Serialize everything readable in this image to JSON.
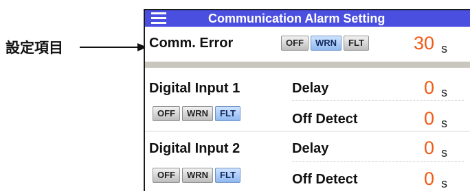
{
  "callout": {
    "label": "設定項目"
  },
  "titlebar": {
    "title": "Communication Alarm Setting",
    "menu_icon": "hamburger-menu-icon"
  },
  "segment_options": [
    "OFF",
    "WRN",
    "FLT"
  ],
  "comm_error": {
    "label": "Comm. Error",
    "selected": "WRN",
    "value": "30",
    "unit": "s"
  },
  "digital_inputs": [
    {
      "label": "Digital Input 1",
      "selected": "FLT",
      "delay_label": "Delay",
      "delay_value": "0",
      "delay_unit": "s",
      "off_detect_label": "Off Detect",
      "off_detect_value": "0",
      "off_detect_unit": "s"
    },
    {
      "label": "Digital Input 2",
      "selected": "FLT",
      "delay_label": "Delay",
      "delay_value": "0",
      "delay_unit": "s",
      "off_detect_label": "Off Detect",
      "off_detect_value": "0",
      "off_detect_unit": "s"
    }
  ],
  "colors": {
    "titlebar": "#4b4fe0",
    "value": "#f05a14",
    "active_button": "#8fb8f0",
    "divider": "#c9c6be"
  }
}
